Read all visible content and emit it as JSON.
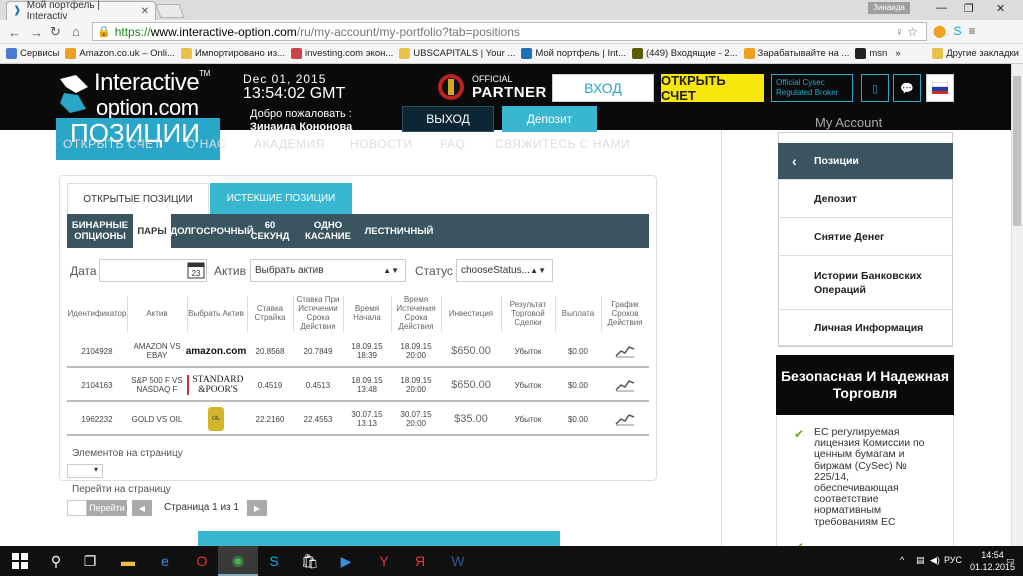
{
  "browser": {
    "tab_title": "Мой портфель | Interactiv",
    "user_badge": "Зинаида",
    "url_https": "https://",
    "url_host": "www.interactive-option.com",
    "url_path": "/ru/my-account/my-portfolio?tab=positions",
    "bookmarks": [
      {
        "label": "Сервисы",
        "color": "#4a7bd0"
      },
      {
        "label": "Amazon.co.uk – Onli...",
        "color": "#f0a020"
      },
      {
        "label": "Импортировано из...",
        "color": "#e8c24a"
      },
      {
        "label": "investing.com экон...",
        "color": "#c44"
      },
      {
        "label": "UBSCAPITALS | Your ...",
        "color": "#e8c24a"
      },
      {
        "label": "Мой портфель | Int...",
        "color": "#1f6fb5"
      },
      {
        "label": "(449) Входящие - 2...",
        "color": "#5a5a00"
      },
      {
        "label": "Зарабатывайте на ...",
        "color": "#f0a020"
      },
      {
        "label": "msn",
        "color": "#222"
      }
    ],
    "other_bookmarks": "Другие закладки"
  },
  "header": {
    "logo_line1": "Interactive",
    "logo_tm": "TM",
    "logo_line2": "option.com",
    "date": "Dec 01, 2015",
    "time": "13:54:02 GMT",
    "welcome": "Добро пожаловать :",
    "user_name": "Зинаида Кононова",
    "partner_small": "OFFICIAL",
    "partner_big": "PARTNER",
    "login": "ВХОД",
    "open_account": "ОТКРЫТЬ СЧЕТ",
    "cysec_line1": "Official Cysec",
    "cysec_line2": "Regulated Broker",
    "exit": "ВЫХОД",
    "deposit": "Депозит"
  },
  "ghost": {
    "title": "ПОЗИЦИИ",
    "nav": [
      "ОТКРЫТЬ СЧЕТ",
      "О НАС",
      "АКАДЕМИЯ",
      "НОВОСТИ",
      "FAQ",
      "СВЯЖИТЕСЬ С НАМИ"
    ],
    "side_title": "My Account"
  },
  "positions": {
    "tab_open": "ОТКРЫТЫЕ ПОЗИЦИИ",
    "tab_expired": "ИСТЕКШИЕ ПОЗИЦИИ",
    "subtabs": [
      "БИНАРНЫЕ ОПЦИОНЫ",
      "ПАРЫ",
      "ДОЛГОСРОЧНЫЙ",
      "60 СЕКУНД",
      "ОДНО КАСАНИЕ",
      "ЛЕСТНИЧНЫЙ"
    ],
    "filter_date": "Дата",
    "filter_asset": "Актив",
    "asset_select": "Выбрать актив",
    "filter_status": "Статус",
    "status_select": "chooseStatus...",
    "columns": [
      "Идентификатор",
      "Актив",
      "Выбрать Актив",
      "Ставка Страйка",
      "Ставка При Истечении Срока Действия",
      "Время Начала",
      "Время Истечения Срока Действия",
      "Инвестиция",
      "Результат Торговой Сделки",
      "Выплата",
      "График Сроков Действия"
    ],
    "rows": [
      {
        "id": "2104928",
        "asset": "AMAZON VS EBAY",
        "logo": "amazon.com",
        "strike": "20.8568",
        "expiry_rate": "20.7849",
        "start": "18.09.15 18:39",
        "expiry": "18.09.15 20:00",
        "invest": "$650.00",
        "result": "Убыток",
        "payout": "$0.00"
      },
      {
        "id": "2104163",
        "asset": "S&P 500 F VS NASDAQ F",
        "logo": "STANDARD &POOR'S",
        "strike": "0.4519",
        "expiry_rate": "0.4513",
        "start": "18.09.15 13:48",
        "expiry": "18.09.15 20:00",
        "invest": "$650.00",
        "result": "Убыток",
        "payout": "$0.00"
      },
      {
        "id": "1962232",
        "asset": "GOLD VS OIL",
        "logo": "OIL",
        "strike": "22.2160",
        "expiry_rate": "22.4553",
        "start": "30.07.15 13:13",
        "expiry": "30.07.15 20:00",
        "invest": "$35.00",
        "result": "Убыток",
        "payout": "$0.00"
      }
    ],
    "per_page_label": "Элементов на страницу",
    "goto_label": "Перейти на страницу",
    "goto_btn": "Перейти",
    "page_text": "Страница 1 из 1"
  },
  "sidebar": {
    "items": [
      "Позиции",
      "Депозит",
      "Снятие Денег",
      "Истории Банковских Операций",
      "Личная Информация"
    ],
    "safe_title": "Безопасная И Надежная Торговля",
    "safe_text": "ЕС регулируемая лицензия Комиссии по ценным бумагам и биржам (CySec) № 225/14, обеспечивающая соответствие нормативным требованиям ЕС"
  },
  "taskbar": {
    "lang": "РУС",
    "time": "14:54",
    "date": "01.12.2015"
  },
  "colors": {
    "accent": "#3ab7d0",
    "dark": "#0a0a0a",
    "nav_dark": "#3a5560",
    "yellow": "#f7e70a"
  }
}
